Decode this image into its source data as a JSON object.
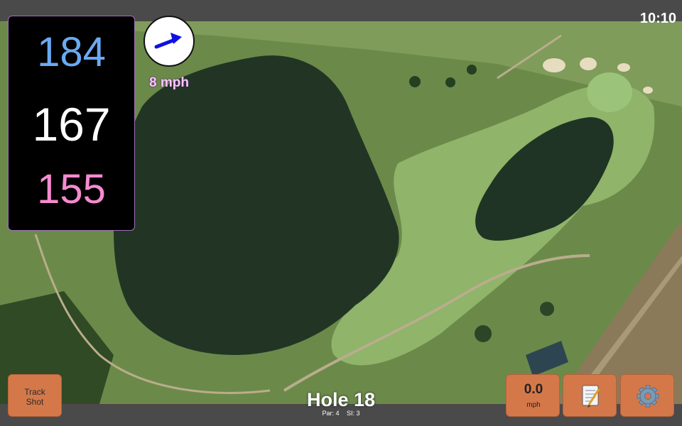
{
  "status": {
    "time": "10:10"
  },
  "distances": {
    "back": "184",
    "middle": "167",
    "front": "155"
  },
  "wind": {
    "speed": "8 mph",
    "arrow_icon": "wind-arrow-icon",
    "arrow_color": "#1010e0"
  },
  "buttons": {
    "track_shot": {
      "line1": "Track",
      "line2": "Shot"
    },
    "speed": {
      "value": "0.0",
      "unit": "mph"
    },
    "notes_icon": "notepad-icon",
    "settings_icon": "gear-icon"
  },
  "hole": {
    "title": "Hole 18",
    "par": "Par: 4",
    "si": "SI: 3"
  },
  "colors": {
    "back_distance": "#6aaaf2",
    "middle_distance": "#ffffff",
    "front_distance": "#f48bcf",
    "button": "#d4784a",
    "wind_text": "#f5c8ff"
  }
}
